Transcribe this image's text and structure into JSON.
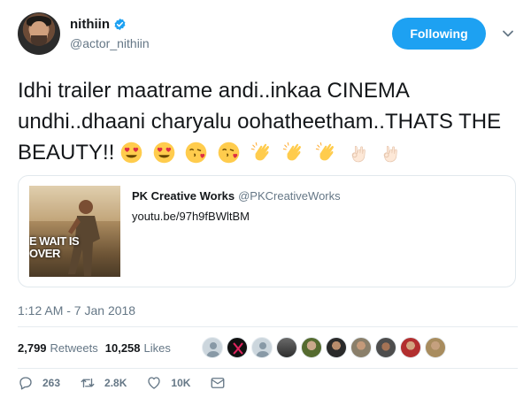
{
  "profile": {
    "display_name": "nithiin",
    "handle": "@actor_nithiin",
    "verified": true
  },
  "follow_button": {
    "label": "Following"
  },
  "tweet": {
    "text": "Idhi trailer maatrame andi..inkaa CINEMA undhi..dhaani charyalu oohatheetham..THATS THE BEAUTY!!",
    "emojis": [
      "heart-eyes-emoji",
      "heart-eyes-emoji",
      "kissing-heart-emoji",
      "kissing-heart-emoji",
      "clapping-hands-emoji",
      "clapping-hands-emoji",
      "clapping-hands-emoji",
      "ok-hand-emoji",
      "ok-hand-emoji"
    ]
  },
  "card": {
    "name": "PK Creative Works",
    "handle": "@PKCreativeWorks",
    "link": "youtu.be/97h9fBWltBM",
    "thumb_text_line1": "E WAIT IS",
    "thumb_text_line2": "OVER"
  },
  "timestamp": "1:12 AM - 7 Jan 2018",
  "stats": {
    "retweets_count": "2,799",
    "retweets_label": "Retweets",
    "likes_count": "10,258",
    "likes_label": "Likes"
  },
  "actions": {
    "replies": "263",
    "retweets": "2.8K",
    "likes": "10K"
  },
  "colors": {
    "accent": "#1da1f2",
    "muted": "#657786",
    "text": "#14171a",
    "border": "#e1e8ed"
  }
}
